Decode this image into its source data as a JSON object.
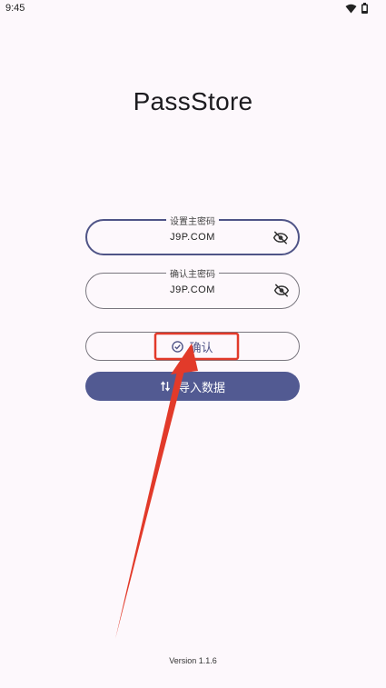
{
  "status_bar": {
    "time": "9:45"
  },
  "app": {
    "title": "PassStore",
    "version": "Version 1.1.6"
  },
  "form": {
    "password": {
      "label": "设置主密码",
      "value": "J9P.COM"
    },
    "confirm_password": {
      "label": "确认主密码",
      "value": "J9P.COM"
    },
    "confirm_button_label": "确认",
    "import_button_label": "导入数据"
  },
  "colors": {
    "accent": "#525a92",
    "annotation": "#e23a2a",
    "background": "#fdf8fc"
  },
  "icons": [
    "wifi-icon",
    "battery-icon",
    "visibility-off-icon",
    "check-circle-icon",
    "swap-vertical-icon"
  ]
}
